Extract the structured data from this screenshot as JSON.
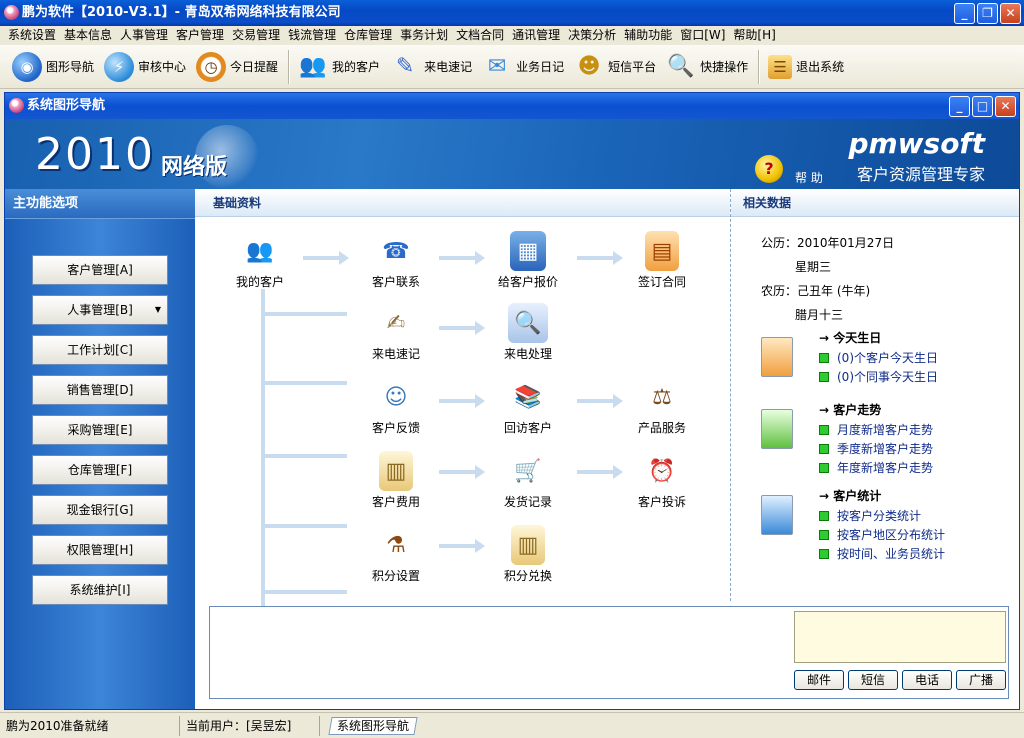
{
  "window": {
    "title": "鹏为软件【2010-V3.1】- 青岛双希网络科技有限公司"
  },
  "menu": [
    "系统设置",
    "基本信息",
    "人事管理",
    "客户管理",
    "交易管理",
    "钱流管理",
    "仓库管理",
    "事务计划",
    "文档合同",
    "通讯管理",
    "决策分析",
    "辅助功能",
    "窗口[W]",
    "帮助[H]"
  ],
  "toolbar": [
    {
      "label": "图形导航",
      "icon": "globe-icon",
      "color": "#1e64c8"
    },
    {
      "label": "审核中心",
      "icon": "lightning-globe-icon",
      "color": "#2a8ad8"
    },
    {
      "label": "今日提醒",
      "icon": "clock-icon",
      "color": "#e08a20"
    },
    {
      "label": "我的客户",
      "icon": "people-icon",
      "color": "#b07030"
    },
    {
      "label": "来电速记",
      "icon": "pen-icon",
      "color": "#3a6ac8"
    },
    {
      "label": "业务日记",
      "icon": "envelope-icon",
      "color": "#3a8ad8"
    },
    {
      "label": "短信平台",
      "icon": "users-icon",
      "color": "#d0a020"
    },
    {
      "label": "快捷操作",
      "icon": "magnifier-icon",
      "color": "#2a6ac0"
    },
    {
      "label": "退出系统",
      "icon": "exit-icon",
      "color": "#e0a030"
    }
  ],
  "inner": {
    "title": "系统图形导航"
  },
  "banner": {
    "year": "2010",
    "edition": "网络版",
    "brand": "pmwsoft",
    "slogan": "客户资源管理专家",
    "help": "帮 助"
  },
  "left": {
    "title": "主功能选项",
    "items": [
      "客户管理[A]",
      "人事管理[B]",
      "工作计划[C]",
      "销售管理[D]",
      "采购管理[E]",
      "仓库管理[F]",
      "现金银行[G]",
      "权限管理[H]",
      "系统维护[I]"
    ]
  },
  "main": {
    "title": "基础资料",
    "nodes": {
      "my_customers": "我的客户",
      "customer_contact": "客户联系",
      "quote": "给客户报价",
      "contract": "签订合同",
      "call_note": "来电速记",
      "call_handle": "来电处理",
      "feedback": "客户反馈",
      "revisit": "回访客户",
      "product_service": "产品服务",
      "expense": "客户费用",
      "delivery": "发货记录",
      "complaint": "客户投诉",
      "points_setting": "积分设置",
      "points_redeem": "积分兑换"
    }
  },
  "right": {
    "title": "相关数据",
    "solar": "公历：2010年01月27日",
    "weekday": "星期三",
    "lunar": "农历：己丑年 (牛年)",
    "lunar_day": "腊月十三",
    "birthday": {
      "title": "→ 今天生日",
      "items": [
        "(0)个客户今天生日",
        "(0)个同事今天生日"
      ]
    },
    "trend": {
      "title": "→ 客户走势",
      "items": [
        "月度新增客户走势",
        "季度新增客户走势",
        "年度新增客户走势"
      ]
    },
    "stats": {
      "title": "→ 客户统计",
      "items": [
        "按客户分类统计",
        "按客户地区分布统计",
        "按时间、业务员统计"
      ]
    }
  },
  "actions": {
    "mail": "邮件",
    "sms": "短信",
    "phone": "电话",
    "broadcast": "广播"
  },
  "status": {
    "ready": "鹏为2010准备就绪",
    "user": "当前用户：[吴昱宏]",
    "tab": "系统图形导航"
  }
}
